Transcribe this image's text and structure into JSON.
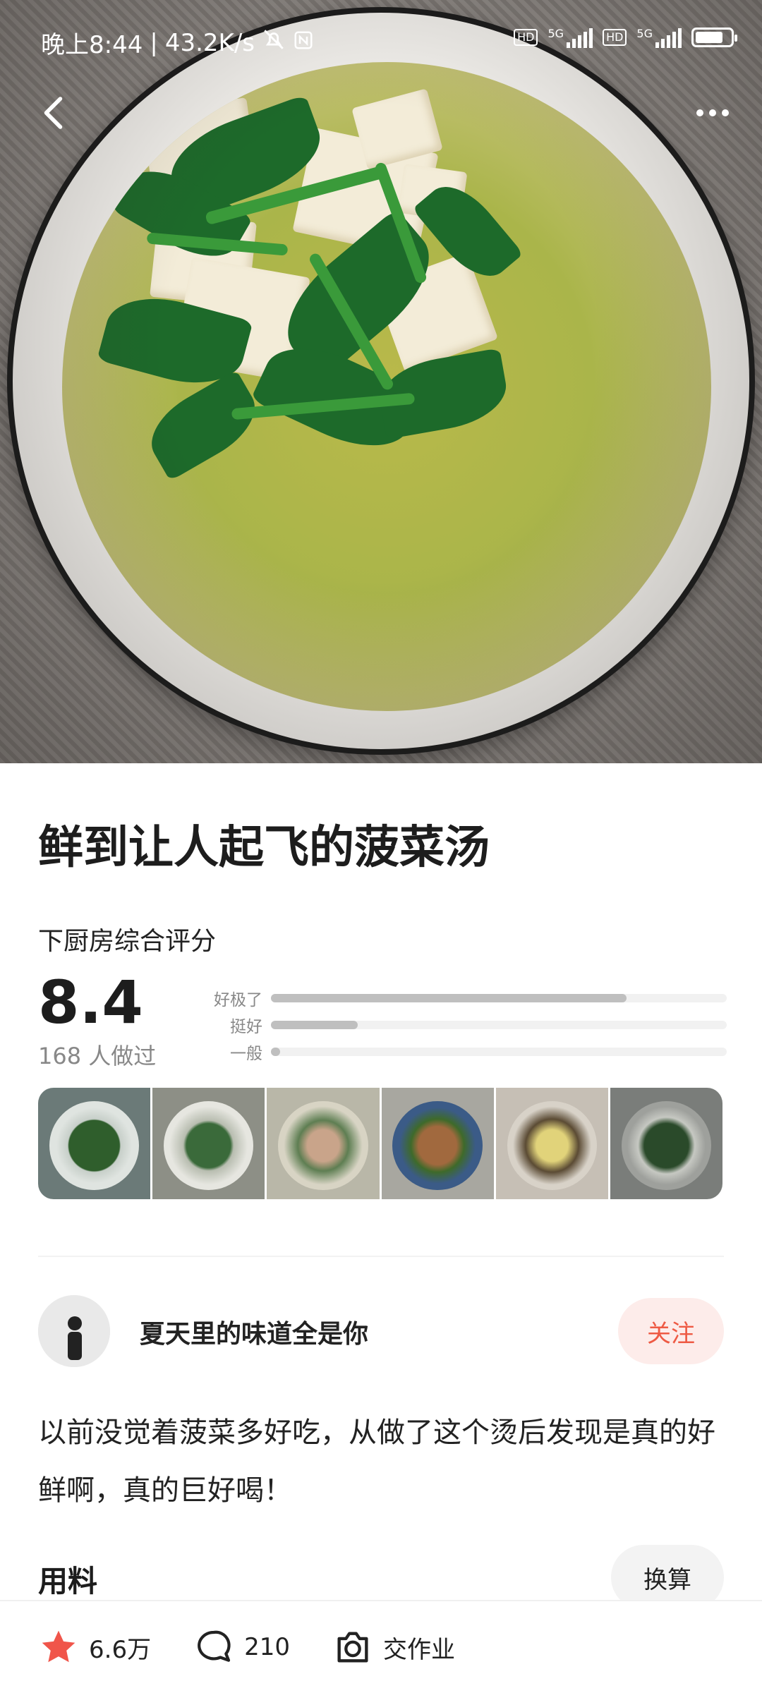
{
  "status_bar": {
    "time": "晚上8:44",
    "net_speed": "43.2K/s",
    "hd1": "HD",
    "net1": "5G",
    "hd2": "HD",
    "net2": "5G",
    "battery_level": 0.8
  },
  "recipe": {
    "title": "鲜到让人起飞的菠菜汤",
    "rating_label": "下厨房综合评分",
    "score": "8.4",
    "made_count": "168 人做过",
    "rating_breakdown": [
      {
        "label": "好极了",
        "fraction": 0.78
      },
      {
        "label": "挺好",
        "fraction": 0.19
      },
      {
        "label": "一般",
        "fraction": 0.02
      }
    ],
    "author": {
      "name": "夏天里的味道全是你",
      "follow_label": "关注"
    },
    "description": "以前没觉着菠菜多好吃，从做了这个烫后发现是真的好鲜啊，真的巨好喝！",
    "ingredients_label": "用料",
    "convert_label": "换算"
  },
  "bottom_bar": {
    "favorites": "6.6万",
    "comments": "210",
    "homework": "交作业"
  },
  "colors": {
    "accent": "#ee5a44",
    "follow_bg": "#fdecea",
    "star": "#f0554a"
  },
  "icons": [
    "back-arrow-icon",
    "more-icon",
    "star-icon",
    "comment-icon",
    "camera-icon"
  ]
}
